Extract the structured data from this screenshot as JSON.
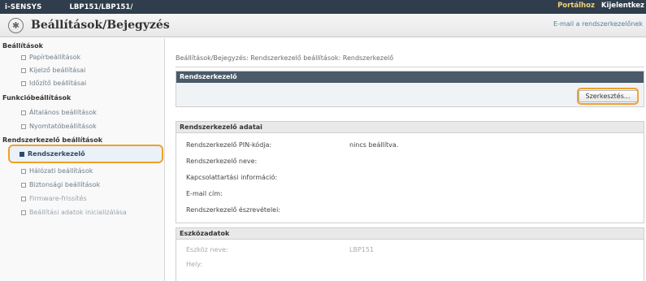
{
  "topbar": {
    "brand": "i-SENSYS",
    "model": "LBP151/LBP151/",
    "portal_link": "Portálhoz",
    "logout_link": "Kijelentkez"
  },
  "titlebar": {
    "title": "Beállítások/Bejegyzés",
    "email_link": "E-mail a rendszerkezelőnek"
  },
  "sidebar": {
    "settings_head": "Beállítások",
    "paper_settings": "Papírbeállítások",
    "display_settings": "Kijelző beállításai",
    "timer_settings": "Időzítő beállításai",
    "function_head": "Funkcióbeállítások",
    "general_settings": "Általános beállítások",
    "printer_settings": "Nyomtatóbeállítások",
    "admin_head": "Rendszerkezelő beállítások",
    "admin": "Rendszerkezelő",
    "network_settings": "Hálózati beállítások",
    "security_settings": "Biztonsági beállítások",
    "firmware_update": "Firmware-frissítés",
    "settings_data": "Beállítási adatok inicializálása"
  },
  "main": {
    "breadcrumb": "Beállítások/Bejegyzés: Rendszerkezelő beállítások: Rendszerkezelő",
    "section1_title": "Rendszerkezelő",
    "edit_button": "Szerkesztés...",
    "section2_title": "Rendszerkezelő adatai",
    "rows": [
      {
        "label": "Rendszerkezelő PIN-kódja:",
        "value": "nincs beállítva."
      },
      {
        "label": "Rendszerkezelő neve:",
        "value": ""
      },
      {
        "label": "Kapcsolattartási információ:",
        "value": ""
      },
      {
        "label": "E-mail cím:",
        "value": ""
      },
      {
        "label": "Rendszerkezelő észrevételei:",
        "value": ""
      }
    ],
    "section3_title": "Eszközadatok",
    "device_rows": [
      {
        "label": "Eszköz neve:",
        "value": "LBP151"
      },
      {
        "label": "Hely:",
        "value": ""
      }
    ]
  }
}
